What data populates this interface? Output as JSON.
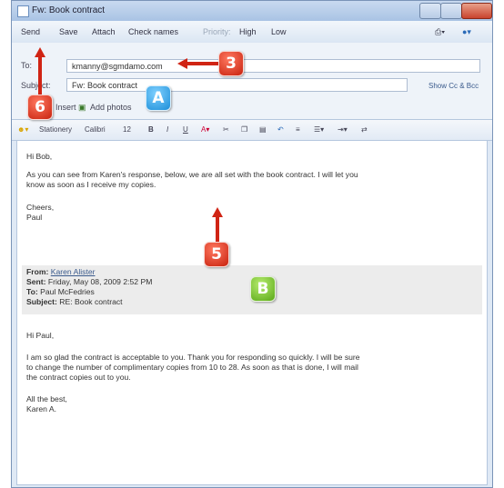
{
  "window": {
    "title": "Fw: Book contract"
  },
  "toolbar": {
    "send": "Send",
    "save": "Save",
    "attach": "Attach",
    "check_names": "Check names",
    "priority": "Priority:",
    "high": "High",
    "low": "Low"
  },
  "headers": {
    "to_label": "To:",
    "to_value": "kmanny@sgmdamo.com",
    "subject_label": "Subject:",
    "subject_value": "Fw: Book contract",
    "show_cc_bcc": "Show Cc & Bcc",
    "insert": "Insert",
    "add_photos": "Add photos"
  },
  "format": {
    "stationery": "Stationery",
    "font": "Calibri",
    "size": "12",
    "bold": "B",
    "italic": "I",
    "underline": "U"
  },
  "message": {
    "greeting": "Hi Bob,",
    "line1": "As you can see from Karen's response, below, we are all set with the book contract. I will let you",
    "line2": "know as soon as I receive my copies.",
    "signoff": "Cheers,",
    "name": "Paul",
    "from_label": "From:",
    "from_value": "Karen Alister",
    "sent_label": "Sent:",
    "sent_value": "Friday, May 08, 2009 2:52 PM",
    "to_label": "To:",
    "to_value": "Paul McFedries",
    "subject_label": "Subject:",
    "subject_value": "RE: Book contract",
    "reply_greeting": "Hi Paul,",
    "reply1": "I am so glad the contract is acceptable to you. Thank you for responding so quickly. I will be sure",
    "reply2": "to change the number of complimentary copies from 10 to 28. As soon as that is done, I will mail",
    "reply3": "the contract copies out to you.",
    "reply_close": "All the best,",
    "reply_name": "Karen A."
  },
  "callouts": {
    "c3": "3",
    "c6": "6",
    "c5": "5",
    "cA": "A",
    "cB": "B"
  },
  "colors": {
    "callout_red": "#d02414",
    "callout_blue": "#1c8ed8",
    "callout_green": "#5aa818"
  }
}
